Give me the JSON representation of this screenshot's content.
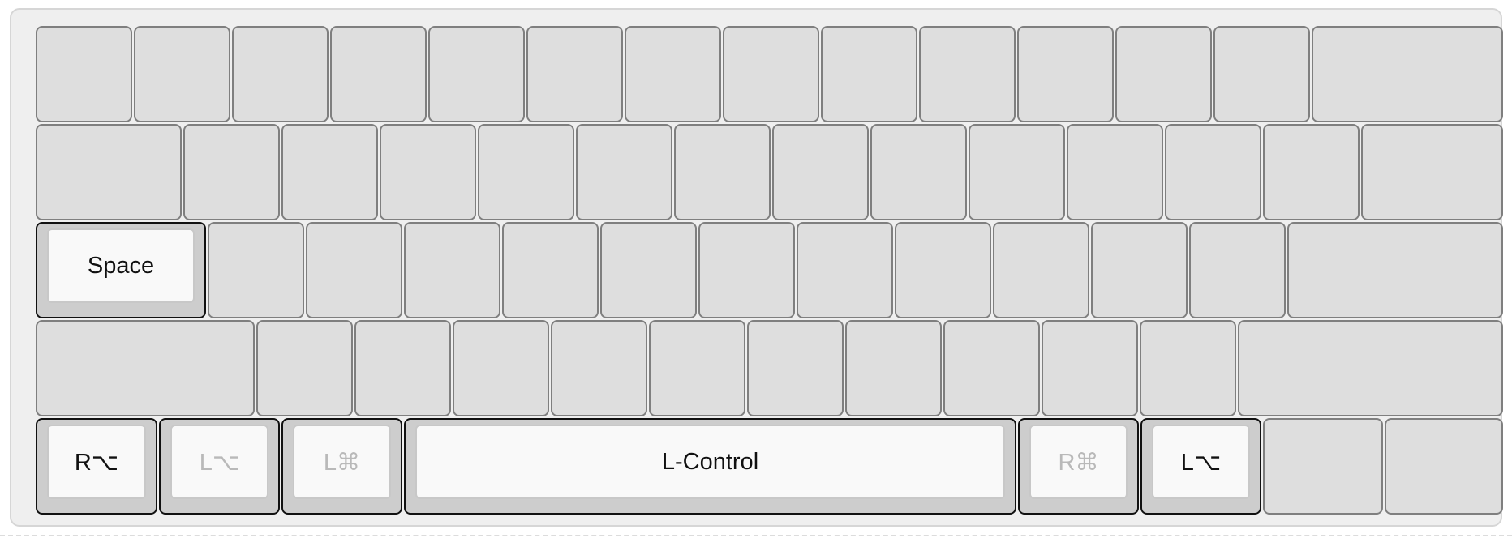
{
  "keyboard": {
    "mapped_keys": {
      "space": {
        "label": "Space",
        "active": true
      },
      "right_option": {
        "label": "R⌥",
        "active": true
      },
      "left_option_dim": {
        "label": "L⌥",
        "active": false
      },
      "left_command": {
        "label": "L⌘",
        "active": false
      },
      "left_control": {
        "label": "L-Control",
        "active": true
      },
      "right_command": {
        "label": "R⌘",
        "active": false
      },
      "left_option": {
        "label": "L⌥",
        "active": true
      }
    }
  }
}
